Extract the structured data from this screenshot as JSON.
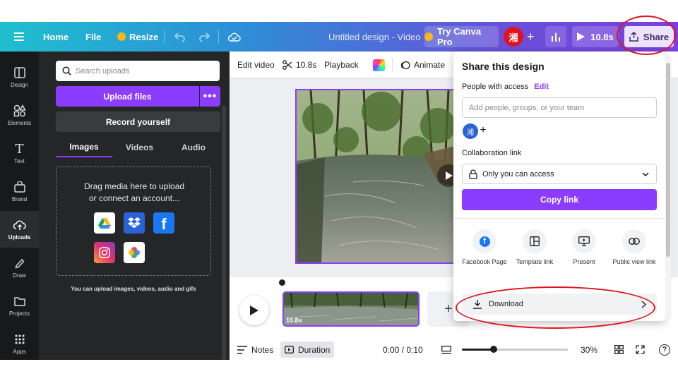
{
  "topbar": {
    "home": "Home",
    "file": "File",
    "resize": "Resize",
    "doc_title": "Untitled design - Video",
    "try_pro": "Try Canva Pro",
    "avatar_initial": "湘",
    "play_duration": "10.8s",
    "share": "Share"
  },
  "rail": {
    "items": [
      {
        "label": "Design",
        "icon": "design-icon"
      },
      {
        "label": "Elements",
        "icon": "elements-icon"
      },
      {
        "label": "Text",
        "icon": "text-icon"
      },
      {
        "label": "Brand",
        "icon": "brand-icon"
      },
      {
        "label": "Uploads",
        "icon": "uploads-icon",
        "active": true
      },
      {
        "label": "Draw",
        "icon": "draw-icon"
      },
      {
        "label": "Projects",
        "icon": "folder-icon"
      },
      {
        "label": "Apps",
        "icon": "apps-icon"
      }
    ]
  },
  "uploads": {
    "search_placeholder": "Search uploads",
    "upload_files": "Upload files",
    "more": "•••",
    "record_yourself": "Record yourself",
    "tabs": [
      "Images",
      "Videos",
      "Audio"
    ],
    "active_tab": "Images",
    "drop_line1": "Drag media here to upload",
    "drop_line2": "or connect an account...",
    "services": [
      "google-drive-icon",
      "dropbox-icon",
      "facebook-icon",
      "instagram-icon",
      "google-photos-icon"
    ],
    "hint": "You can upload images, videos, audio and gifs"
  },
  "editor": {
    "toolbar": {
      "edit_video": "Edit video",
      "duration": "10.8s",
      "playback": "Playback",
      "animate": "Animate"
    },
    "clip_duration": "10.8s",
    "add_clip": "+",
    "bottom": {
      "notes": "Notes",
      "duration": "Duration",
      "time": "0:00 / 0:10",
      "zoom": "30%",
      "zoom_level": 0.3
    }
  },
  "share": {
    "title": "Share this design",
    "people_label": "People with access",
    "edit_link": "Edit",
    "people_placeholder": "Add people, groups, or your team",
    "avatar_initial": "湘",
    "collab_label": "Collaboration link",
    "access_value": "Only you can access",
    "copy_link": "Copy link",
    "options": [
      {
        "label": "Facebook Page",
        "icon": "facebook-icon"
      },
      {
        "label": "Template link",
        "icon": "template-icon"
      },
      {
        "label": "Present",
        "icon": "present-icon"
      },
      {
        "label": "Public view link",
        "icon": "link-icon"
      }
    ],
    "download": "Download"
  },
  "colors": {
    "accent": "#8b3dff",
    "annotation": "#e0141e",
    "panel": "#252627",
    "rail": "#18191b"
  }
}
